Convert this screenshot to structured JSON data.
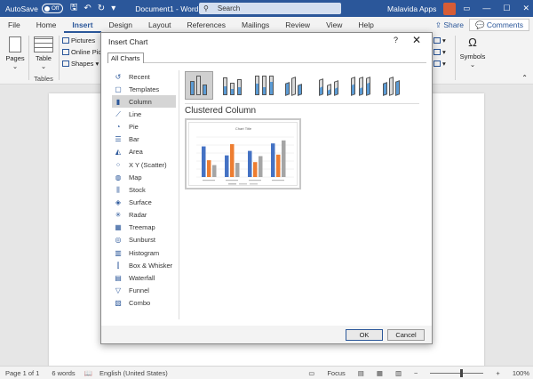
{
  "titlebar": {
    "autosave_label": "AutoSave",
    "autosave_state": "Off",
    "doc_title": "Document1 - Word",
    "search_placeholder": "Search",
    "user_name": "Malavida Apps"
  },
  "tabs": [
    "File",
    "Home",
    "Insert",
    "Design",
    "Layout",
    "References",
    "Mailings",
    "Review",
    "View",
    "Help"
  ],
  "active_tab": "Insert",
  "ribbon": {
    "share_label": "Share",
    "comments_label": "Comments",
    "pages_label": "Pages",
    "table_label": "Table",
    "tables_group_label": "Tables",
    "pictures_label": "Pictures",
    "online_pictures_label": "Online Pic",
    "shapes_label": "Shapes",
    "symbols_label": "Symbols"
  },
  "dialog": {
    "title": "Insert Chart",
    "help_label": "?",
    "close_label": "✕",
    "all_charts_tab": "All Charts",
    "selected_type_title": "Clustered Column",
    "ok_label": "OK",
    "cancel_label": "Cancel",
    "categories": [
      {
        "label": "Recent",
        "icon": "recent-icon"
      },
      {
        "label": "Templates",
        "icon": "templates-icon"
      },
      {
        "label": "Column",
        "icon": "column-chart-icon"
      },
      {
        "label": "Line",
        "icon": "line-chart-icon"
      },
      {
        "label": "Pie",
        "icon": "pie-chart-icon"
      },
      {
        "label": "Bar",
        "icon": "bar-chart-icon"
      },
      {
        "label": "Area",
        "icon": "area-chart-icon"
      },
      {
        "label": "X Y (Scatter)",
        "icon": "scatter-chart-icon"
      },
      {
        "label": "Map",
        "icon": "map-chart-icon"
      },
      {
        "label": "Stock",
        "icon": "stock-chart-icon"
      },
      {
        "label": "Surface",
        "icon": "surface-chart-icon"
      },
      {
        "label": "Radar",
        "icon": "radar-chart-icon"
      },
      {
        "label": "Treemap",
        "icon": "treemap-chart-icon"
      },
      {
        "label": "Sunburst",
        "icon": "sunburst-chart-icon"
      },
      {
        "label": "Histogram",
        "icon": "histogram-chart-icon"
      },
      {
        "label": "Box & Whisker",
        "icon": "box-whisker-chart-icon"
      },
      {
        "label": "Waterfall",
        "icon": "waterfall-chart-icon"
      },
      {
        "label": "Funnel",
        "icon": "funnel-chart-icon"
      },
      {
        "label": "Combo",
        "icon": "combo-chart-icon"
      }
    ],
    "active_category": "Column",
    "preview_title": "Chart Title",
    "series_colors": [
      "#4472c4",
      "#ed7d31",
      "#a5a5a5"
    ]
  },
  "statusbar": {
    "page": "Page 1 of 1",
    "words": "6 words",
    "language": "English (United States)",
    "focus": "Focus",
    "zoom": "100%"
  }
}
